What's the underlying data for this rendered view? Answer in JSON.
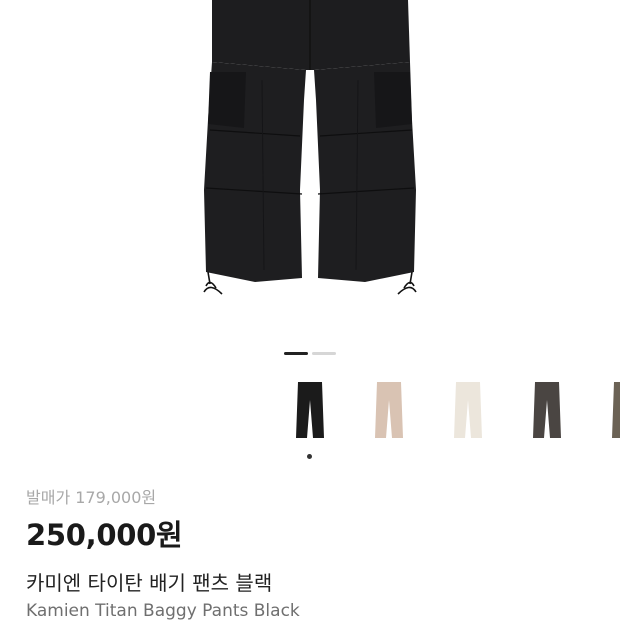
{
  "product": {
    "release_price": "발매가 179,000원",
    "price": "250,000원",
    "name_ko": "카미엔 타이탄 배기 팬츠 블랙",
    "name_en": "Kamien Titan Baggy Pants Black",
    "image_colors": {
      "pants": "#1c1c1e",
      "shadow": "#0f0f10"
    }
  },
  "carousel": {
    "current_page": 1,
    "total_pages": 2
  },
  "variants": [
    {
      "name": "black",
      "color": "#1b1b1b",
      "selected": true
    },
    {
      "name": "beige",
      "color": "#d9c3b3",
      "selected": false
    },
    {
      "name": "ivory",
      "color": "#ece6dc",
      "selected": false
    },
    {
      "name": "charcoal",
      "color": "#4a4542",
      "selected": false
    },
    {
      "name": "khaki",
      "color": "#6b6255",
      "selected": false
    }
  ]
}
